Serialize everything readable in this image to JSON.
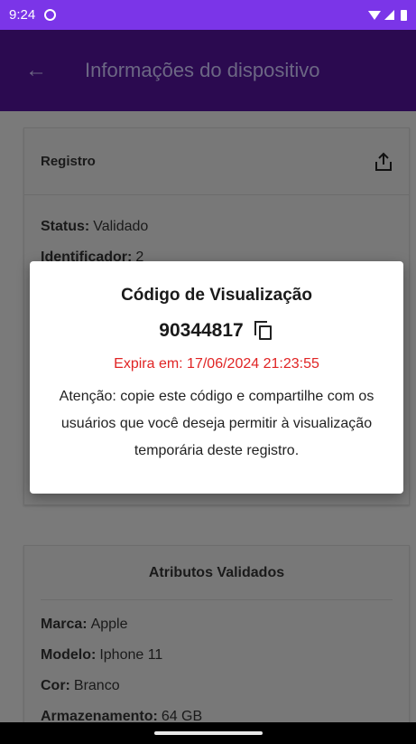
{
  "status_bar": {
    "time": "9:24"
  },
  "app_bar": {
    "title": "Informações do dispositivo"
  },
  "registro_card": {
    "title": "Registro",
    "rows": [
      {
        "label": "Status:",
        "value": "Validado"
      },
      {
        "label": "Identificador:",
        "value": "2"
      }
    ]
  },
  "atributos_card": {
    "title": "Atributos Validados",
    "rows": [
      {
        "label": "Marca:",
        "value": "Apple"
      },
      {
        "label": "Modelo:",
        "value": "Iphone 11"
      },
      {
        "label": "Cor:",
        "value": "Branco"
      },
      {
        "label": "Armazenamento:",
        "value": "64 GB"
      }
    ]
  },
  "dialog": {
    "title": "Código de Visualização",
    "code": "90344817",
    "expires": "Expira em: 17/06/2024 21:23:55",
    "message": "Atenção: copie este código e compartilhe com os usuários que você deseja permitir à visualização temporária deste registro."
  },
  "colors": {
    "status_bar": "#7b35e8",
    "app_bar": "#2b0a50",
    "expires": "#e02424"
  }
}
